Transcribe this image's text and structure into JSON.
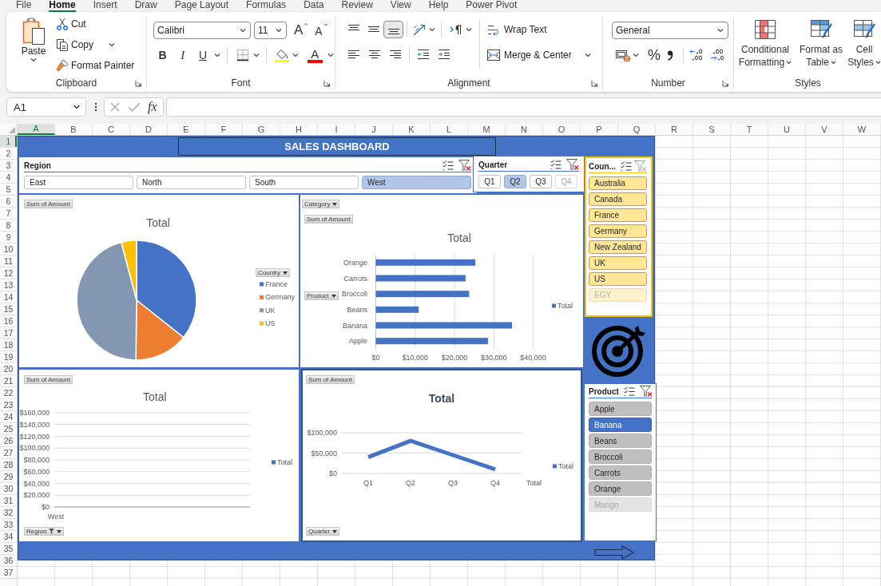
{
  "ribbon_tabs": [
    {
      "label": "File",
      "selected": false
    },
    {
      "label": "Home",
      "selected": true
    },
    {
      "label": "Insert",
      "selected": false
    },
    {
      "label": "Draw",
      "selected": false
    },
    {
      "label": "Page Layout",
      "selected": false
    },
    {
      "label": "Formulas",
      "selected": false
    },
    {
      "label": "Data",
      "selected": false
    },
    {
      "label": "Review",
      "selected": false
    },
    {
      "label": "View",
      "selected": false
    },
    {
      "label": "Help",
      "selected": false
    },
    {
      "label": "Power Pivot",
      "selected": false
    }
  ],
  "clipboard": {
    "paste": "Paste",
    "cut": "Cut",
    "copy": "Copy",
    "format_painter": "Format Painter",
    "label": "Clipboard"
  },
  "font": {
    "font_name": "Calibri",
    "font_size": "11",
    "grow_font": "A",
    "shrink_font": "A",
    "bold": "B",
    "italic": "I",
    "underline": "U",
    "font_color": "A",
    "label": "Font"
  },
  "alignment": {
    "vertical_align": [
      {
        "selected": false
      },
      {
        "selected": false
      },
      {
        "selected": true
      }
    ],
    "wrap_text": "Wrap Text",
    "merge_center": "Merge & Center",
    "label": "Alignment"
  },
  "number": {
    "format": "General",
    "percent": "%",
    "label": "Number"
  },
  "styles": {
    "buttons": [
      "Conditional Formatting",
      "Format as Table",
      "Cell Styles"
    ],
    "label": "Styles"
  },
  "formula_bar": {
    "name_box": "A1",
    "insert_function": "fx"
  },
  "columns": [
    {
      "label": "A",
      "selected": true
    },
    {
      "label": "B",
      "selected": false
    },
    {
      "label": "C",
      "selected": false
    },
    {
      "label": "D",
      "selected": false
    },
    {
      "label": "E",
      "selected": false
    },
    {
      "label": "F",
      "selected": false
    },
    {
      "label": "G",
      "selected": false
    },
    {
      "label": "H",
      "selected": false
    },
    {
      "label": "I",
      "selected": false
    },
    {
      "label": "J",
      "selected": false
    },
    {
      "label": "K",
      "selected": false
    },
    {
      "label": "L",
      "selected": false
    },
    {
      "label": "M",
      "selected": false
    },
    {
      "label": "N",
      "selected": false
    },
    {
      "label": "O",
      "selected": false
    },
    {
      "label": "P",
      "selected": false
    },
    {
      "label": "Q",
      "selected": false
    },
    {
      "label": "R",
      "selected": false
    },
    {
      "label": "S",
      "selected": false
    },
    {
      "label": "T",
      "selected": false
    },
    {
      "label": "U",
      "selected": false
    },
    {
      "label": "V",
      "selected": false
    },
    {
      "label": "W",
      "selected": false
    }
  ],
  "rows": [
    {
      "label": "1",
      "selected": true
    },
    {
      "label": "2",
      "selected": false
    },
    {
      "label": "3",
      "selected": false
    },
    {
      "label": "4",
      "selected": false
    },
    {
      "label": "5",
      "selected": false
    },
    {
      "label": "6",
      "selected": false
    },
    {
      "label": "7",
      "selected": false
    },
    {
      "label": "8",
      "selected": false
    },
    {
      "label": "9",
      "selected": false
    },
    {
      "label": "10",
      "selected": false
    },
    {
      "label": "11",
      "selected": false
    },
    {
      "label": "12",
      "selected": false
    },
    {
      "label": "13",
      "selected": false
    },
    {
      "label": "14",
      "selected": false
    },
    {
      "label": "15",
      "selected": false
    },
    {
      "label": "16",
      "selected": false
    },
    {
      "label": "17",
      "selected": false
    },
    {
      "label": "18",
      "selected": false
    },
    {
      "label": "19",
      "selected": false
    },
    {
      "label": "20",
      "selected": false
    },
    {
      "label": "21",
      "selected": false
    },
    {
      "label": "22",
      "selected": false
    },
    {
      "label": "23",
      "selected": false
    },
    {
      "label": "24",
      "selected": false
    },
    {
      "label": "25",
      "selected": false
    },
    {
      "label": "26",
      "selected": false
    },
    {
      "label": "27",
      "selected": false
    },
    {
      "label": "28",
      "selected": false
    },
    {
      "label": "29",
      "selected": false
    },
    {
      "label": "30",
      "selected": false
    },
    {
      "label": "31",
      "selected": false
    },
    {
      "label": "32",
      "selected": false
    },
    {
      "label": "33",
      "selected": false
    },
    {
      "label": "34",
      "selected": false
    },
    {
      "label": "35",
      "selected": false
    },
    {
      "label": "36",
      "selected": false
    },
    {
      "label": "37",
      "selected": false
    }
  ],
  "dashboard": {
    "title": "SALES DASHBOARD",
    "region_slicer": {
      "title": "Region",
      "filtered": true,
      "items": [
        {
          "label": "East",
          "selected": false,
          "disabled": false
        },
        {
          "label": "North",
          "selected": false,
          "disabled": false
        },
        {
          "label": "South",
          "selected": false,
          "disabled": false
        },
        {
          "label": "West",
          "selected": true,
          "disabled": false
        }
      ]
    },
    "quarter_slicer": {
      "title": "Quarter",
      "filtered": true,
      "items": [
        {
          "label": "Q1",
          "selected": false,
          "disabled": false
        },
        {
          "label": "Q2",
          "selected": true,
          "disabled": false
        },
        {
          "label": "Q3",
          "selected": false,
          "disabled": false
        },
        {
          "label": "Q4",
          "selected": false,
          "disabled": true
        }
      ]
    },
    "country_slicer": {
      "title": "Coun...",
      "filtered": false,
      "items": [
        {
          "label": "Australia",
          "selected": true,
          "disabled": false
        },
        {
          "label": "Canada",
          "selected": true,
          "disabled": false
        },
        {
          "label": "France",
          "selected": true,
          "disabled": false
        },
        {
          "label": "Germany",
          "selected": true,
          "disabled": false
        },
        {
          "label": "New Zealand",
          "selected": true,
          "disabled": false
        },
        {
          "label": "UK",
          "selected": true,
          "disabled": false
        },
        {
          "label": "US",
          "selected": true,
          "disabled": false
        },
        {
          "label": "EGY",
          "selected": true,
          "disabled": true
        }
      ]
    },
    "pie_chart": {
      "field_button": "Sum of Amount",
      "title": "Total",
      "legend_button": {
        "label": "Country",
        "filtered": false
      },
      "legend": [
        {
          "label": "France",
          "color": "#4472c4"
        },
        {
          "label": "Germany",
          "color": "#ed7d31"
        },
        {
          "label": "UK",
          "color": "#8497b0"
        },
        {
          "label": "US",
          "color": "#ffc000"
        }
      ]
    },
    "bar_chart": {
      "filter_button": {
        "label": "Category",
        "filtered": false
      },
      "field_button": "Sum of Amount",
      "axis_button": {
        "label": "Product",
        "filtered": false
      },
      "chart_data": [
        {
          "type": "bar",
          "orientation": "horizontal",
          "title": "Total",
          "categories": [
            "Orange",
            "Carrots",
            "Broccoli",
            "Beans",
            "Banana",
            "Apple"
          ],
          "series": [
            {
              "name": "Total",
              "color": "#4472c4",
              "values": [
                25300,
                22800,
                23700,
                10900,
                34600,
                28500
              ]
            }
          ],
          "xlim": [
            0,
            40000
          ],
          "xticks": [
            {
              "value": 0,
              "label": "$0"
            },
            {
              "value": 10000,
              "label": "$10,000"
            },
            {
              "value": 20000,
              "label": "$20,000"
            },
            {
              "value": 30000,
              "label": "$30,000"
            },
            {
              "value": 40000,
              "label": "$40,000"
            }
          ],
          "grid": true,
          "legend": "right"
        }
      ]
    },
    "column_chart": {
      "field_button": "Sum of Amount",
      "title": "Total",
      "axis_button": {
        "label": "Region",
        "filtered": true
      },
      "chart_data": [
        {
          "type": "bar",
          "categories": [
            "West"
          ],
          "series": [
            {
              "name": "Total",
              "color": "#4472c4",
              "values": [
                null
              ]
            }
          ],
          "ylim": [
            0,
            160000
          ],
          "yticks": [
            {
              "value": 0,
              "label": "$0"
            },
            {
              "value": 20000,
              "label": "$20,000"
            },
            {
              "value": 40000,
              "label": "$40,000"
            },
            {
              "value": 60000,
              "label": "$60,000"
            },
            {
              "value": 80000,
              "label": "$80,000"
            },
            {
              "value": 100000,
              "label": "$100,000"
            },
            {
              "value": 120000,
              "label": "$120,000"
            },
            {
              "value": 140000,
              "label": "$140,000"
            },
            {
              "value": 160000,
              "label": "$160,000"
            }
          ],
          "grid": true,
          "legend": "right"
        }
      ]
    },
    "line_chart": {
      "field_button": "Sum of Amount",
      "axis_button": {
        "label": "Quarter",
        "filtered": false
      },
      "chart_data": [
        {
          "type": "line",
          "title": "Total",
          "categories": [
            "Q1",
            "Q2",
            "Q3",
            "Q4"
          ],
          "series": [
            {
              "name": "Total",
              "color": "#4472c4",
              "values": [
                40000,
                80000,
                45000,
                10000
              ]
            }
          ],
          "ylim": [
            0,
            100000
          ],
          "yticks": [
            {
              "value": 0,
              "label": "$0"
            },
            {
              "value": 50000,
              "label": "$50,000"
            },
            {
              "value": 100000,
              "label": "$100,000"
            }
          ],
          "grid": true,
          "legend": "right",
          "annotations": [
            "Total"
          ]
        }
      ]
    },
    "product_slicer": {
      "title": "Product",
      "filtered": true,
      "items": [
        {
          "label": "Apple",
          "selected": false,
          "disabled": false
        },
        {
          "label": "Banana",
          "selected": true,
          "disabled": false
        },
        {
          "label": "Beans",
          "selected": false,
          "disabled": false
        },
        {
          "label": "Broccoli",
          "selected": false,
          "disabled": false
        },
        {
          "label": "Carrots",
          "selected": false,
          "disabled": false
        },
        {
          "label": "Orange",
          "selected": false,
          "disabled": false
        },
        {
          "label": "Mango",
          "selected": false,
          "disabled": true
        }
      ]
    }
  }
}
